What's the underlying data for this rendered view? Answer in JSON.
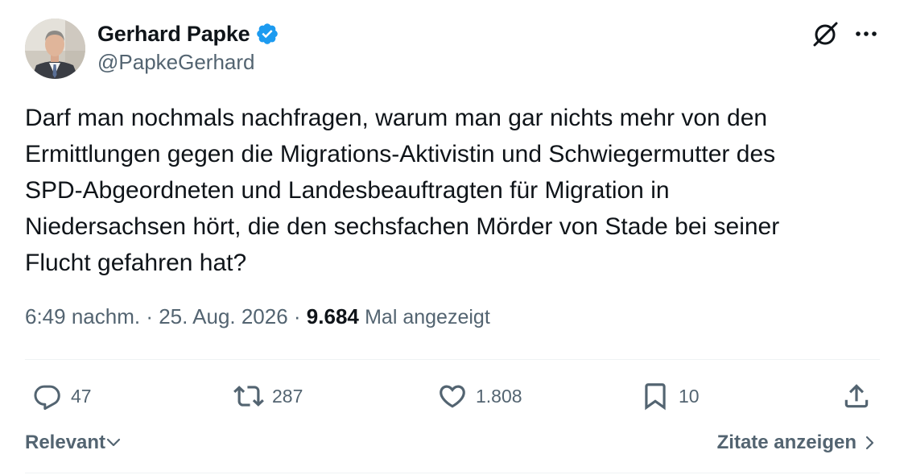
{
  "author": {
    "display_name": "Gerhard Papke",
    "handle": "@PapkeGerhard",
    "verified": true
  },
  "tweet": {
    "lines": [
      "Darf man nochmals nachfragen, warum man gar nichts mehr von den",
      "Ermittlungen gegen die Migrations-Aktivistin und Schwiegermutter des",
      "SPD-Abgeordneten und Landesbeauftragten für Migration in",
      "Niedersachsen hört, die den sechsfachen Mörder von Stade bei seiner",
      "Flucht gefahren hat?"
    ]
  },
  "meta": {
    "time": "6:49 nachm.",
    "separator": " · ",
    "date": "25. Aug. 2026",
    "views_count": "9.684",
    "views_label": "Mal angezeigt"
  },
  "actions": {
    "replies": "47",
    "reposts": "287",
    "likes": "1.808",
    "bookmarks": "10"
  },
  "footer": {
    "sort_label": "Relevant",
    "quotes_label": "Zitate anzeigen"
  },
  "icons": {
    "verified": "verified-badge-icon",
    "grok": "grok-icon",
    "more": "more-dots-icon",
    "reply": "reply-icon",
    "repost": "repost-icon",
    "like": "heart-icon",
    "bookmark": "bookmark-icon",
    "share": "share-icon"
  },
  "colors": {
    "text_primary": "#0f1419",
    "text_secondary": "#536471",
    "verified_blue": "#1d9bf0",
    "divider": "#eff3f4"
  }
}
